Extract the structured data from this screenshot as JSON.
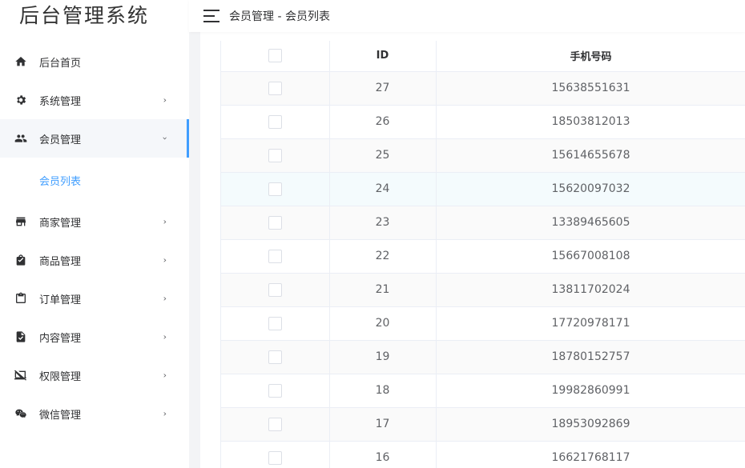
{
  "app": {
    "title": "后台管理系统"
  },
  "header": {
    "breadcrumb": "会员管理 - 会员列表"
  },
  "sidebar": {
    "items": [
      {
        "label": "后台首页",
        "icon": "home-icon",
        "has_children": false
      },
      {
        "label": "系统管理",
        "icon": "gear-icon",
        "has_children": true
      },
      {
        "label": "会员管理",
        "icon": "people-icon",
        "has_children": true,
        "open": true,
        "children": [
          {
            "label": "会员列表",
            "active": true
          }
        ]
      },
      {
        "label": "商家管理",
        "icon": "store-icon",
        "has_children": true
      },
      {
        "label": "商品管理",
        "icon": "shopping-bag-icon",
        "has_children": true
      },
      {
        "label": "订单管理",
        "icon": "clipboard-icon",
        "has_children": true
      },
      {
        "label": "内容管理",
        "icon": "document-check-icon",
        "has_children": true
      },
      {
        "label": "权限管理",
        "icon": "screen-off-icon",
        "has_children": true
      },
      {
        "label": "微信管理",
        "icon": "wechat-icon",
        "has_children": true
      }
    ]
  },
  "table": {
    "columns": [
      "",
      "ID",
      "手机号码"
    ],
    "rows": [
      {
        "id": "27",
        "phone": "15638551631"
      },
      {
        "id": "26",
        "phone": "18503812013"
      },
      {
        "id": "25",
        "phone": "15614655678"
      },
      {
        "id": "24",
        "phone": "15620097032"
      },
      {
        "id": "23",
        "phone": "13389465605"
      },
      {
        "id": "22",
        "phone": "15667008108"
      },
      {
        "id": "21",
        "phone": "13811702024"
      },
      {
        "id": "20",
        "phone": "17720978171"
      },
      {
        "id": "19",
        "phone": "18780152757"
      },
      {
        "id": "18",
        "phone": "19982860991"
      },
      {
        "id": "17",
        "phone": "18953092869"
      },
      {
        "id": "16",
        "phone": "16621768117"
      }
    ]
  },
  "colors": {
    "accent": "#409eff",
    "stripe": "#fafafa",
    "hover_row": "#f4fbfd",
    "border": "#ebeef5"
  }
}
